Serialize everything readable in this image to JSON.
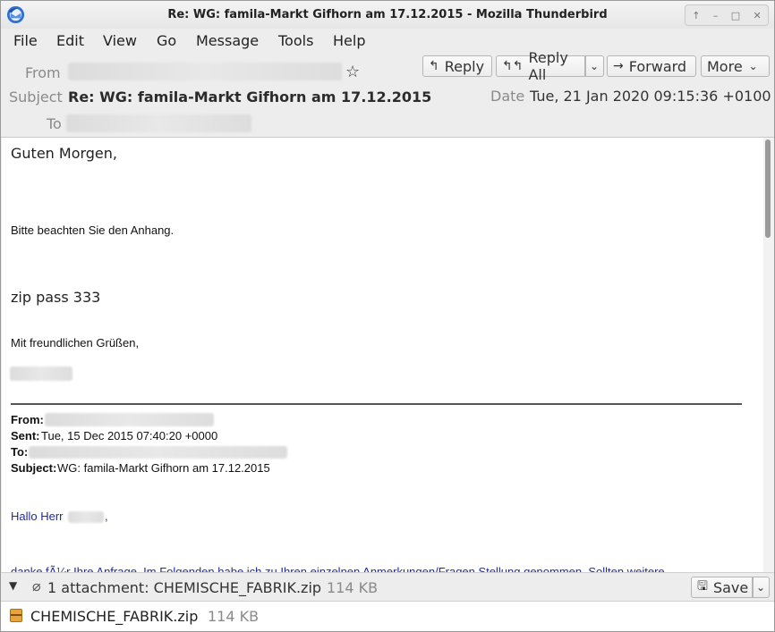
{
  "window": {
    "title": "Re: WG: famila-Markt Gifhorn am 17.12.2015 - Mozilla Thunderbird",
    "controls": [
      "↑",
      "–",
      "□",
      "✕"
    ]
  },
  "menu": [
    {
      "label": "File"
    },
    {
      "label": "Edit"
    },
    {
      "label": "View"
    },
    {
      "label": "Go"
    },
    {
      "label": "Message"
    },
    {
      "label": "Tools"
    },
    {
      "label": "Help"
    }
  ],
  "header": {
    "from_label": "From",
    "subject_label": "Subject",
    "subject": "Re: WG: famila-Markt Gifhorn am 17.12.2015",
    "to_label": "To",
    "date_label": "Date",
    "date": "Tue, 21 Jan 2020 09:15:36 +0100",
    "buttons": {
      "reply": "Reply",
      "reply_all": "Reply All",
      "forward": "Forward",
      "more": "More"
    }
  },
  "body": {
    "greeting": "Guten Morgen,",
    "line1": "Bitte beachten Sie den Anhang.",
    "zip_pass": "zip pass 333",
    "closing": "Mit freundlichen Grüßen,",
    "quoted": {
      "from_label": "From:",
      "sent_label": "Sent:",
      "sent": "Tue, 15 Dec 2015 07:40:20 +0000",
      "to_label": "To:",
      "subject_label": "Subject:",
      "subject": "WG: famila-Markt Gifhorn am 17.12.2015"
    },
    "hello": "Hallo Herr",
    "hello_suffix": ",",
    "cut_line": "danke fÃ¼r Ihre Anfrage. Im Folgenden habe ich zu Ihren einzelnen Anmerkungen/Fragen Stellung genommen. Sollten weitere"
  },
  "attachments": {
    "summary": "1 attachment: CHEMISCHE_FABRIK.zip",
    "summary_size": "114 KB",
    "save_label": "Save",
    "items": [
      {
        "name": "CHEMISCHE_FABRIK.zip",
        "size": "114 KB"
      }
    ]
  }
}
